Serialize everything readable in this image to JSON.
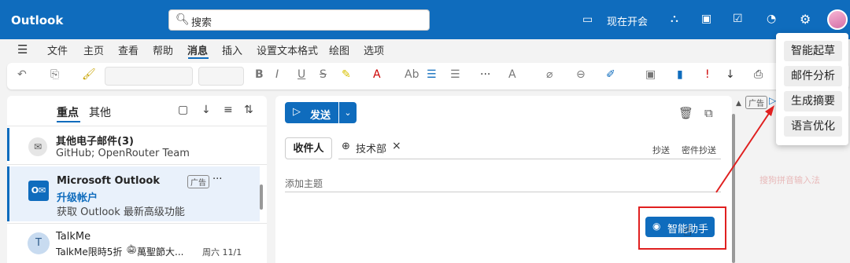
{
  "app": {
    "title": "Outlook"
  },
  "search": {
    "placeholder": "搜索"
  },
  "topbar": {
    "meet_now": "现在开会"
  },
  "menu_tabs": [
    "文件",
    "主页",
    "查看",
    "帮助",
    "消息",
    "插入",
    "设置文本格式",
    "绘图",
    "选项"
  ],
  "active_tab": "消息",
  "folder_tabs": {
    "focused": "重点",
    "other": "其他"
  },
  "messages": [
    {
      "sender": "其他电子邮件(3)",
      "line2": "GitHub; OpenRouter Team"
    },
    {
      "sender": "Microsoft Outlook",
      "badge": "广告",
      "more": "···",
      "headline": "升级帐户",
      "preview": "获取 Outlook 最新高级功能"
    },
    {
      "avatar": "T",
      "sender": "TalkMe",
      "subject": "TalkMe限時5折",
      "subject_tail": "萬聖節大...",
      "date": "周六 11/1"
    }
  ],
  "compose": {
    "send_label": "发送",
    "to_label": "收件人",
    "recipient": "技术部",
    "cc_label": "抄送",
    "bcc_label": "密件抄送",
    "subject_placeholder": "添加主题",
    "assistant_label": "智能助手"
  },
  "ad": {
    "badge": "广告"
  },
  "ime_label": "搜狗拼音输入法",
  "popup_menu": [
    "智能起草",
    "邮件分析",
    "生成摘要",
    "语言优化"
  ],
  "colors": {
    "brand": "#0f6cbd",
    "annotation": "#e02020"
  }
}
